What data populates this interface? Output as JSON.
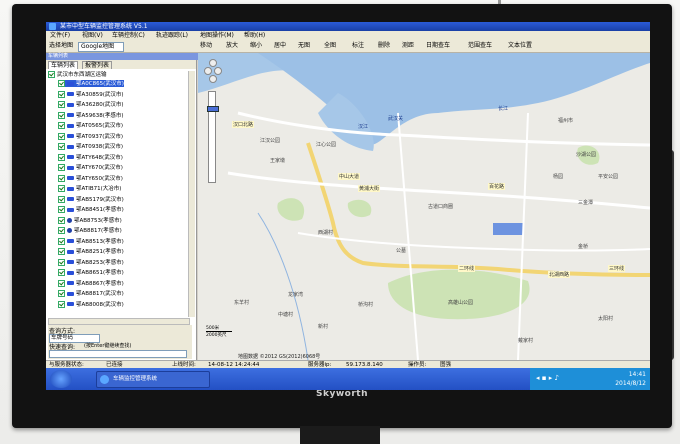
{
  "app": {
    "title": "某市中型车辆监控管理系统 V5.1"
  },
  "menu": [
    "文件(F)",
    "视图(V)",
    "车辆控制(C)",
    "轨迹跟踪(L)",
    "地图操作(M)",
    "帮助(H)"
  ],
  "toolbar": {
    "map_select_label": "选择地图",
    "map_select_value": "Google地图",
    "tools": [
      "移动",
      "放大",
      "缩小",
      "居中",
      "无图",
      "全图",
      "标注",
      "删除",
      "测距",
      "日期查车",
      "范围查车",
      "文本位置"
    ]
  },
  "left_panel": {
    "title": "车辆列表",
    "tabs": [
      "车辆列表",
      "报警列表"
    ],
    "group": "武汉市东西湖区运输",
    "vehicles": [
      "鄂A0C865(武汉市)",
      "鄂A30859(武汉市)",
      "鄂A36280(武汉市)",
      "鄂A59638(孝感市)",
      "鄂AT0565(武汉市)",
      "鄂AT0937(武汉市)",
      "鄂AT0938(武汉市)",
      "鄂ATY648(武汉市)",
      "鄂ATY670(武汉市)",
      "鄂ATY650(武汉市)",
      "鄂ATIB71(大冶市)",
      "鄂AB5179(武汉市)",
      "鄂AB8451(孝感市)",
      "鄂AB8753(孝感市)",
      "鄂AB8817(孝感市)",
      "鄂AB8513(孝感市)",
      "鄂AB8251(孝感市)",
      "鄂AB8253(孝感市)",
      "鄂AB8651(孝感市)",
      "鄂AB8867(孝感市)",
      "鄂AB8817(武汉市)",
      "鄂AB8008(武汉市)"
    ],
    "query": {
      "label": "查询方式:",
      "type_value": "车牌号码",
      "quick_label": "快速查询:",
      "quick_hint": "(按Enter键继续查找)"
    }
  },
  "map": {
    "labels": [
      {
        "t": "汉口北路",
        "k": "road"
      },
      {
        "t": "武汉关",
        "k": "place"
      },
      {
        "t": "江汉公园",
        "k": "place"
      },
      {
        "t": "江心公园",
        "k": "place"
      },
      {
        "t": "王家墩",
        "k": "place"
      },
      {
        "t": "中山大道",
        "k": "road"
      },
      {
        "t": "黄浦大街",
        "k": "road"
      },
      {
        "t": "汉江",
        "k": "place"
      },
      {
        "t": "长江",
        "k": "place"
      },
      {
        "t": "福州市",
        "k": "place"
      },
      {
        "t": "沙湖公园",
        "k": "place"
      },
      {
        "t": "平安公园",
        "k": "place"
      },
      {
        "t": "杨园",
        "k": "place"
      },
      {
        "t": "三金潭",
        "k": "place"
      },
      {
        "t": "古道口商圈",
        "k": "place"
      },
      {
        "t": "百花路",
        "k": "road"
      },
      {
        "t": "公墓",
        "k": "place"
      },
      {
        "t": "二环线",
        "k": "road"
      },
      {
        "t": "北湖西路",
        "k": "road"
      },
      {
        "t": "高雄山公园",
        "k": "place"
      },
      {
        "t": "龙家湾",
        "k": "place"
      },
      {
        "t": "东羊村",
        "k": "place"
      },
      {
        "t": "中塘村",
        "k": "place"
      },
      {
        "t": "桥沟村",
        "k": "place"
      },
      {
        "t": "新村",
        "k": "place"
      },
      {
        "t": "太阳村",
        "k": "place"
      },
      {
        "t": "西湖村",
        "k": "place"
      },
      {
        "t": "三环线",
        "k": "road"
      },
      {
        "t": "金桥",
        "k": "place"
      },
      {
        "t": "戴家村",
        "k": "place"
      }
    ],
    "scale": [
      "500米",
      "2000英尺"
    ],
    "copyright": "地图数据 ©2012 GS(2012)6068号"
  },
  "status": {
    "server_label": "与服务器状态:",
    "server_value": "已连接",
    "last_time_label": "上线时间:",
    "last_time_value": "14-08-12 14:24:44",
    "ip_label": "服务器ip:",
    "ip_value": "59.173.8.140",
    "user_label": "操作员:",
    "user_value": "图强"
  },
  "taskbar": {
    "item": "车辆监控管理系统",
    "time": "14:41",
    "date": "2014/8/12"
  },
  "brand": "Skyworth"
}
